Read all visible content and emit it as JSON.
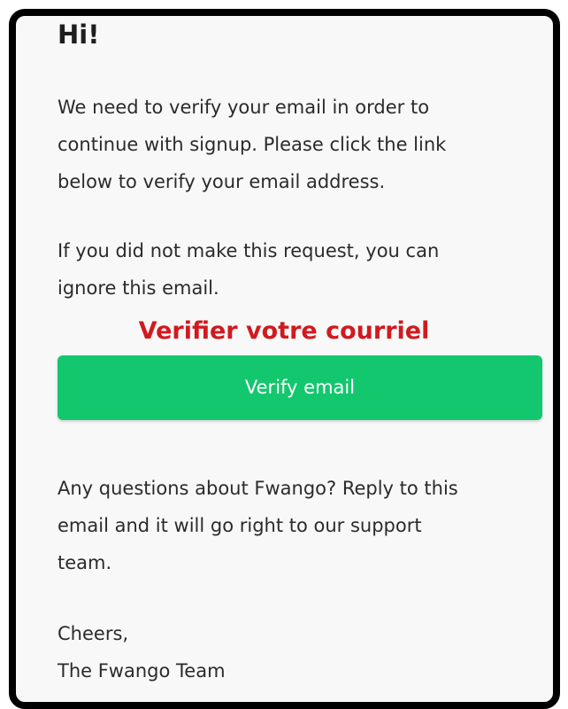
{
  "email": {
    "greeting": "Hi!",
    "paragraph1": [
      "We need to verify your email in order to",
      "continue with signup. Please click the link",
      "below to verify your email address."
    ],
    "paragraph2": [
      "If you did not make this request, you can",
      "ignore this email."
    ],
    "overlay_title": "Verifier votre courriel",
    "verify_button_label": "Verify email",
    "paragraph3": [
      "Any questions about Fwango? Reply to this",
      "email and it will go right to our support",
      "team."
    ],
    "signoff": [
      "Cheers,",
      "The Fwango Team"
    ]
  },
  "colors": {
    "button_green": "#13c76e",
    "overlay_red": "#d11a1f",
    "frame_black": "#000000",
    "text": "#2b2b2b"
  }
}
